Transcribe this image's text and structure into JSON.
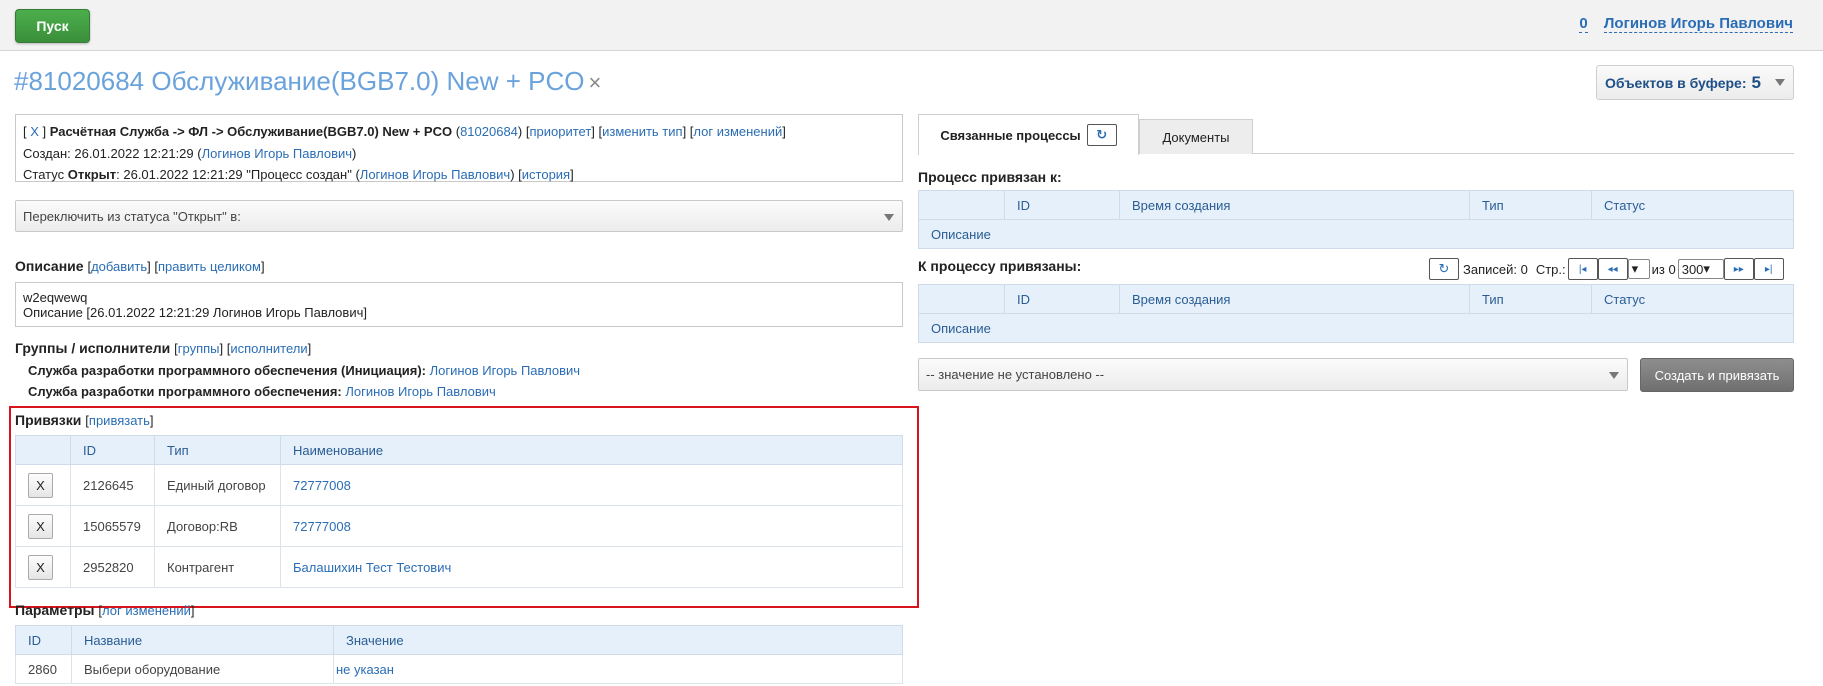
{
  "topbar": {
    "start_label": "Пуск",
    "counter": "0",
    "user": "Логинов Игорь Павлович"
  },
  "title": {
    "text": "#81020684 Обслуживание(BGB7.0) New + PCO",
    "close": "×"
  },
  "buffer": {
    "label": "Объектов в буфере:",
    "count": "5"
  },
  "info": {
    "close": "X",
    "path": "Расчётная Служба -> ФЛ -> Обслуживание(BGB7.0) New + PCO",
    "id": "81020684",
    "priority": "приоритет",
    "change_type": "изменить тип",
    "change_log": "лог изменений",
    "created_label": "Создан: 26.01.2022 12:21:29 (",
    "created_user": "Логинов Игорь Павлович",
    "status_label": "Статус",
    "status_value": "Открыт",
    "status_text": ": 26.01.2022 12:21:29 \"Процесс создан\" (",
    "status_user": "Логинов Игорь Павлович",
    "history": "история"
  },
  "status_switch": {
    "placeholder": "Переключить из статуса \"Открыт\" в:"
  },
  "description": {
    "heading": "Описание",
    "add": "добавить",
    "edit_all": "править целиком",
    "text": "w2eqwewq",
    "meta": "Описание [26.01.2022 12:21:29 Логинов Игорь Павлович]"
  },
  "groups": {
    "heading": "Группы / исполнители",
    "groups_link": "группы",
    "executors_link": "исполнители",
    "rows": [
      {
        "name": "Служба разработки программного обеспечения (Инициация):",
        "user": "Логинов Игорь Павлович"
      },
      {
        "name": "Служба разработки программного обеспечения:",
        "user": "Логинов Игорь Павлович"
      }
    ]
  },
  "links": {
    "heading": "Привязки",
    "bind": "привязать",
    "columns": [
      "",
      "ID",
      "Тип",
      "Наименование"
    ],
    "rows": [
      {
        "btn": "X",
        "id": "2126645",
        "type": "Единый договор",
        "name": "72777008"
      },
      {
        "btn": "X",
        "id": "15065579",
        "type": "Договор:RB",
        "name": "72777008"
      },
      {
        "btn": "X",
        "id": "2952820",
        "type": "Контрагент",
        "name": "Балашихин Тест Тестович"
      }
    ]
  },
  "params": {
    "heading": "Параметры",
    "log": "лог изменений",
    "columns": [
      "ID",
      "Название",
      "Значение"
    ],
    "rows": [
      {
        "id": "2860",
        "name": "Выбери оборудование",
        "value": "не указан"
      }
    ]
  },
  "right": {
    "tab_related": "Связанные процессы",
    "tab_docs": "Документы",
    "linked_to_heading": "Процесс привязан к:",
    "linked_from_heading": "К процессу привязаны:",
    "columns": [
      "",
      "ID",
      "Время создания",
      "Тип",
      "Статус"
    ],
    "desc_label": "Описание",
    "pager": {
      "records": "Записей: 0",
      "page": "Стр.:",
      "of": "из 0",
      "page_size": "300"
    },
    "select_placeholder": "-- значение не установлено --",
    "create_bind": "Создать и привязать"
  }
}
